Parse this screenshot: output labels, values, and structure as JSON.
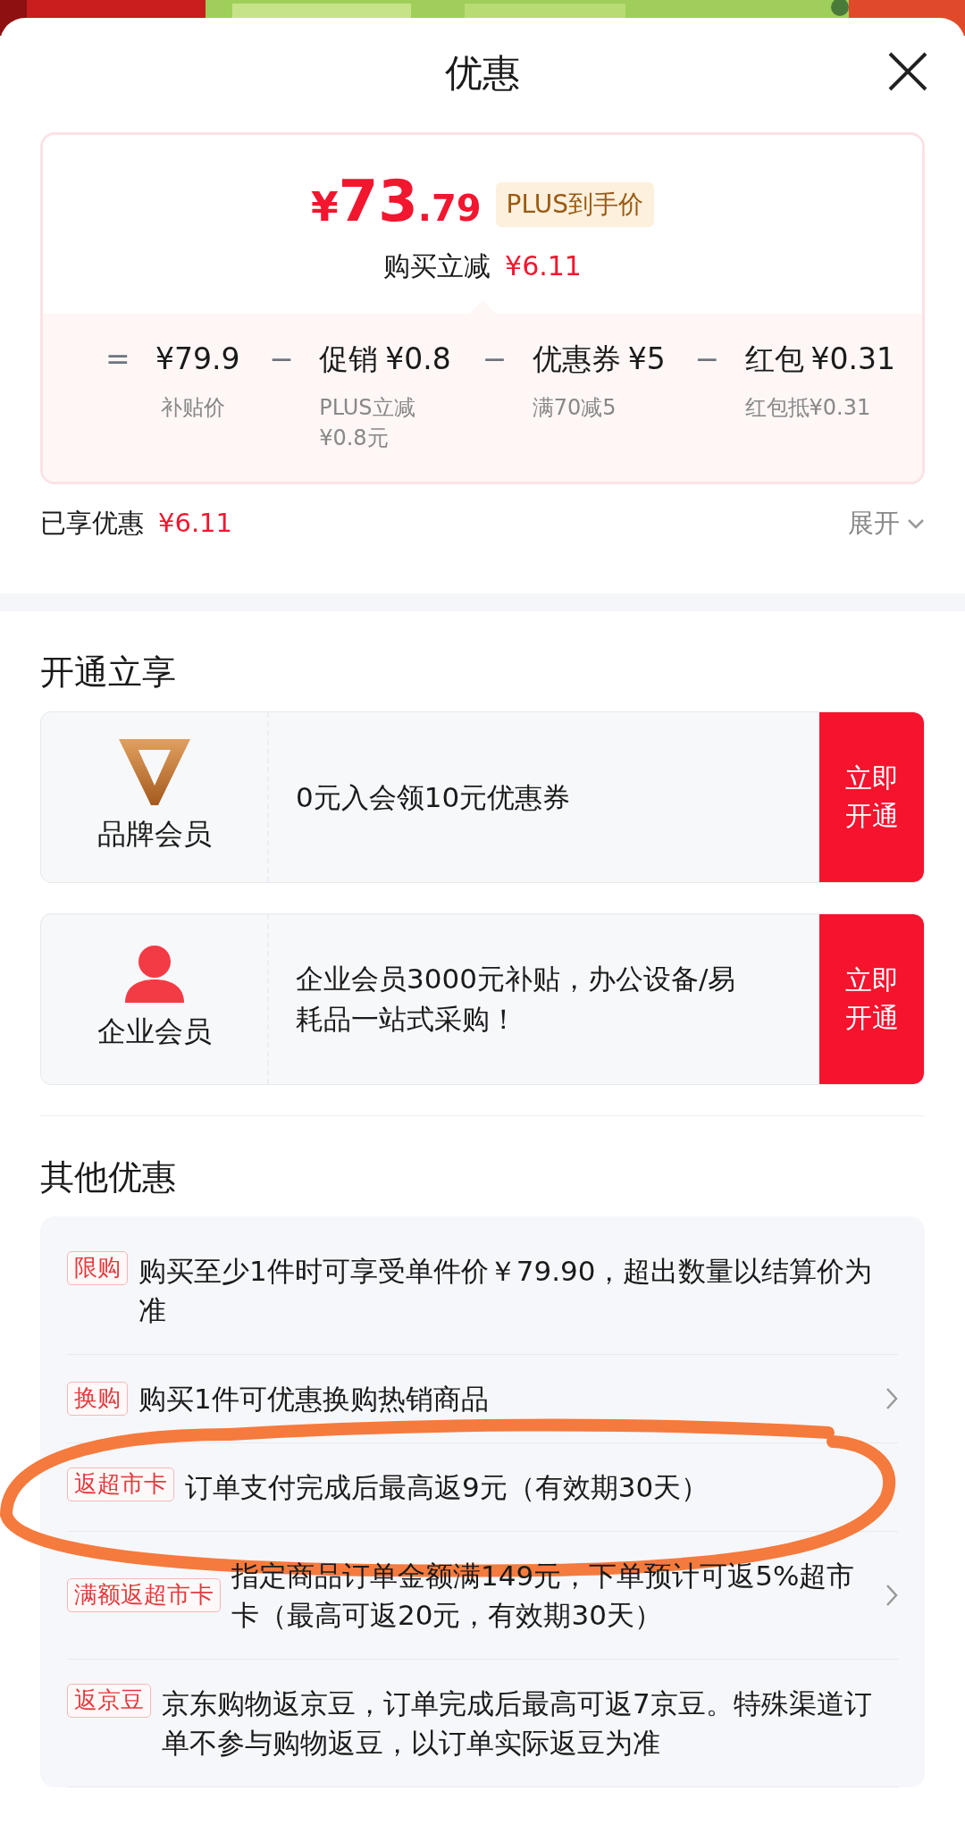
{
  "header": {
    "title": "优惠"
  },
  "summary": {
    "price_symbol": "¥",
    "price_int": "73",
    "price_dec": ".79",
    "price_tag": "PLUS到手价",
    "reduction_label": "购买立减",
    "reduction_value": "¥6.11",
    "breakdown": [
      {
        "operator": "=",
        "value": "¥79.9",
        "note": "补贴价"
      },
      {
        "operator": "−",
        "label": "促销",
        "value": "¥0.8",
        "note": "PLUS立减¥0.8元"
      },
      {
        "operator": "−",
        "label": "优惠券",
        "value": "¥5",
        "note": "满70减5"
      },
      {
        "operator": "−",
        "label": "红包",
        "value": "¥0.31",
        "note": "红包抵¥0.31"
      }
    ]
  },
  "enjoyed": {
    "label": "已享优惠",
    "value": "¥6.11"
  },
  "expand": {
    "label": "展开",
    "expanded": false
  },
  "open_section": {
    "title": "开通立享",
    "cards": [
      {
        "kind": "brand",
        "name": "品牌会员",
        "text": "0元入会领10元优惠券",
        "button": "立即开通"
      },
      {
        "kind": "enterprise",
        "name": "企业会员",
        "text": "企业会员3000元补贴，办公设备/易耗品一站式采购！",
        "button": "立即开通"
      }
    ]
  },
  "other_section": {
    "title": "其他优惠",
    "offers": [
      {
        "tag": "限购",
        "text": "购买至少1件时可享受单件价￥79.90，超出数量以结算价为准",
        "has_arrow": false,
        "circled": false
      },
      {
        "tag": "换购",
        "text": "购买1件可优惠换购热销商品",
        "has_arrow": true,
        "circled": false
      },
      {
        "tag": "返超市卡",
        "text": "订单支付完成后最高返9元（有效期30天）",
        "has_arrow": false,
        "circled": true
      },
      {
        "tag": "满额返超市卡",
        "text": "指定商品订单金额满149元，下单预计可返5%超市卡（最高可返20元，有效期30天）",
        "has_arrow": true,
        "circled": false
      },
      {
        "tag": "返京豆",
        "text": "京东购物返京豆，订单完成后最高可返7京豆。特殊渠道订单不参与购物返豆，以订单实际返豆为准",
        "has_arrow": false,
        "circled": false
      }
    ]
  }
}
